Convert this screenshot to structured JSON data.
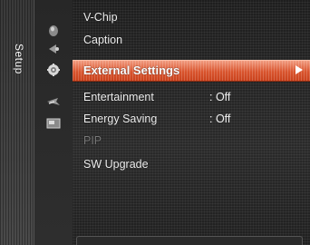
{
  "sidebar": {
    "label": "Setup",
    "icons": [
      "picture-icon",
      "sound-icon",
      "setup-icon",
      "input-icon",
      "application-icon"
    ]
  },
  "menu": {
    "items": [
      {
        "label": "V-Chip",
        "value": ""
      },
      {
        "label": "Caption",
        "value": ""
      },
      {
        "label": "External Settings",
        "value": "",
        "selected": true
      },
      {
        "label": "Entertainment",
        "value": ": Off"
      },
      {
        "label": "Energy Saving",
        "value": ": Off"
      },
      {
        "label": "PIP",
        "value": "",
        "disabled": true
      },
      {
        "label": "SW Upgrade",
        "value": ""
      }
    ]
  },
  "colors": {
    "highlight": "#d9542d",
    "text": "#f0f0f0",
    "disabled_text": "#7a7a7a"
  }
}
